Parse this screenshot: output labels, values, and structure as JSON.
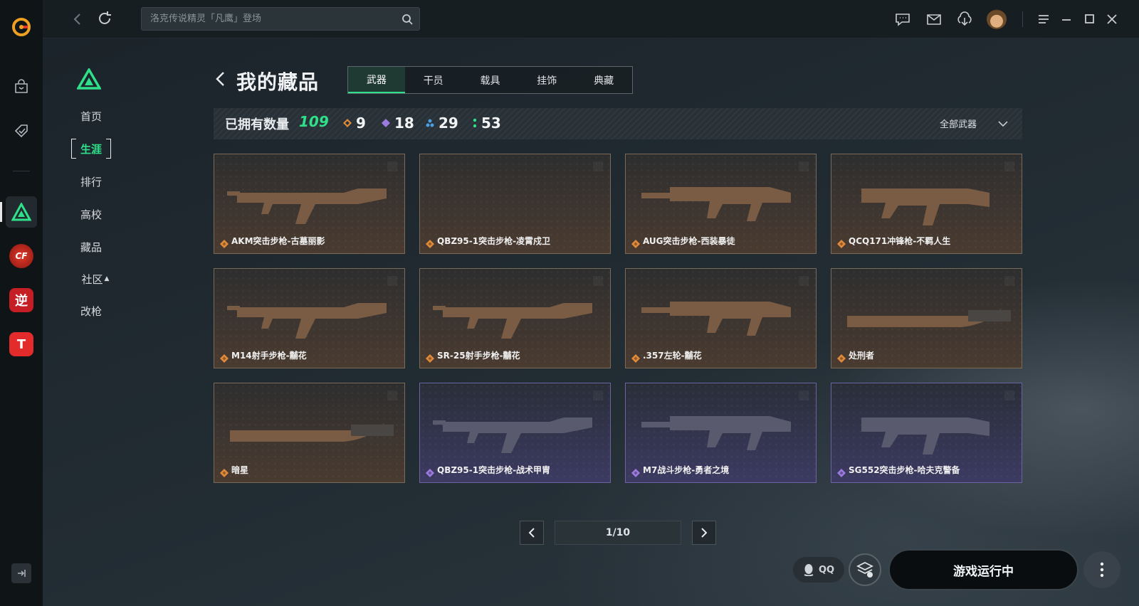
{
  "search": {
    "placeholder": "洛克传说精灵「凡鹰」登场"
  },
  "subnav": {
    "items": [
      {
        "label": "首页",
        "active": false
      },
      {
        "label": "生涯",
        "active": true
      },
      {
        "label": "排行",
        "active": false
      },
      {
        "label": "高校",
        "active": false
      },
      {
        "label": "藏品",
        "active": false
      },
      {
        "label": "社区",
        "active": false
      },
      {
        "label": "改枪",
        "active": false
      }
    ]
  },
  "rail": {
    "game_icons": [
      {
        "text": "CF"
      },
      {
        "text": "逆"
      },
      {
        "text": "T"
      }
    ]
  },
  "page": {
    "title": "我的藏品",
    "tabs": [
      {
        "label": "武器",
        "active": true
      },
      {
        "label": "干员",
        "active": false
      },
      {
        "label": "载具",
        "active": false
      },
      {
        "label": "挂饰",
        "active": false
      },
      {
        "label": "典藏",
        "active": false
      }
    ]
  },
  "stats": {
    "label": "已拥有数量",
    "total": "109",
    "counts": [
      {
        "value": "9",
        "color": "#e08a3a"
      },
      {
        "value": "18",
        "color": "#9b7be0"
      },
      {
        "value": "29",
        "color": "#4aa0e0"
      },
      {
        "value": "53",
        "color": "#2fe08a"
      }
    ],
    "filter_label": "全部武器"
  },
  "items": [
    {
      "name": "AKM突击步枪-古墓丽影",
      "rarity_color": "#e08a3a",
      "style": "gold"
    },
    {
      "name": "QBZ95-1突击步枪-凌霄戍卫",
      "rarity_color": "#e08a3a",
      "style": "gold"
    },
    {
      "name": "AUG突击步枪-西装暴徒",
      "rarity_color": "#e08a3a",
      "style": "gold"
    },
    {
      "name": "QCQ171冲锋枪-不羁人生",
      "rarity_color": "#e08a3a",
      "style": "gold"
    },
    {
      "name": "M14射手步枪-黼花",
      "rarity_color": "#e08a3a",
      "style": "gold"
    },
    {
      "name": "SR-25射手步枪-黼花",
      "rarity_color": "#e08a3a",
      "style": "gold"
    },
    {
      "name": ".357左轮-黼花",
      "rarity_color": "#e08a3a",
      "style": "gold"
    },
    {
      "name": "处刑者",
      "rarity_color": "#e08a3a",
      "style": "gold"
    },
    {
      "name": "暗星",
      "rarity_color": "#e08a3a",
      "style": "gold"
    },
    {
      "name": "QBZ95-1突击步枪-战术甲胄",
      "rarity_color": "#9b7be0",
      "style": "purple"
    },
    {
      "name": "M7战斗步枪-勇者之境",
      "rarity_color": "#9b7be0",
      "style": "purple"
    },
    {
      "name": "SG552突击步枪-哈夫克警备",
      "rarity_color": "#9b7be0",
      "style": "purple"
    }
  ],
  "pagination": {
    "label": "1/10"
  },
  "footer": {
    "qq_label": "QQ",
    "launch_label": "游戏运行中"
  },
  "colors": {
    "accent": "#2fe08a",
    "gold": "#e08a3a",
    "purple": "#9b7be0"
  }
}
